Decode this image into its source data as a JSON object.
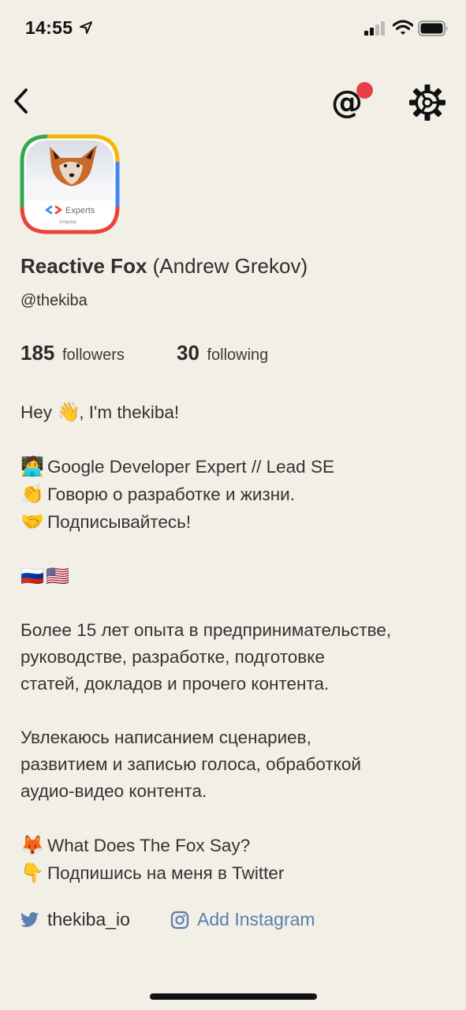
{
  "status_bar": {
    "time": "14:55"
  },
  "header": {
    "back_icon": "chevron-left-icon",
    "mentions_icon": "at-sign-icon",
    "mentions_glyph": "@",
    "settings_icon": "gear-icon",
    "notification_color": "#E5404A"
  },
  "profile": {
    "display_name": "Reactive Fox",
    "real_name": "(Andrew Grekov)",
    "handle": "@thekiba",
    "avatar_badge": {
      "title": "Experts",
      "subtitle": "Angular"
    },
    "stats": {
      "followers_count": "185",
      "followers_label": "followers",
      "following_count": "30",
      "following_label": "following"
    }
  },
  "bio": {
    "greeting_a": "Hey",
    "greeting_emoji": "👋",
    "greeting_b": ", I'm thekiba!",
    "lines": [
      {
        "emoji": "🧑‍💻",
        "text": "Google Developer Expert // Lead SE"
      },
      {
        "emoji": "👏",
        "text": "Говорю о разработке и жизни."
      },
      {
        "emoji": "🤝",
        "text": "Подписывайтесь!"
      }
    ],
    "flags": [
      "🇷🇺",
      "🇺🇸"
    ],
    "paragraph1": [
      "Более 15 лет опыта в предпринимательстве,",
      "руководстве, разработке, подготовке",
      "статей, докладов и прочего контента."
    ],
    "paragraph2": [
      "Увлекаюсь написанием сценариев,",
      "развитием и записью голоса, обработкой",
      "аудио-видео контента."
    ],
    "fox_line": {
      "emoji": "🦊",
      "text": "What Does The Fox Say?"
    },
    "point_line": {
      "emoji": "👇",
      "text": "Подпишись на меня в Twitter"
    }
  },
  "social": {
    "twitter_icon": "twitter-bird-icon",
    "twitter_handle": "thekiba_io",
    "instagram_icon": "instagram-icon",
    "instagram_label": "Add Instagram",
    "link_color": "#5A7FB0"
  },
  "colors": {
    "background": "#F2EFE6",
    "text": "#2f2f2f",
    "accent": "#5A7FB0"
  }
}
